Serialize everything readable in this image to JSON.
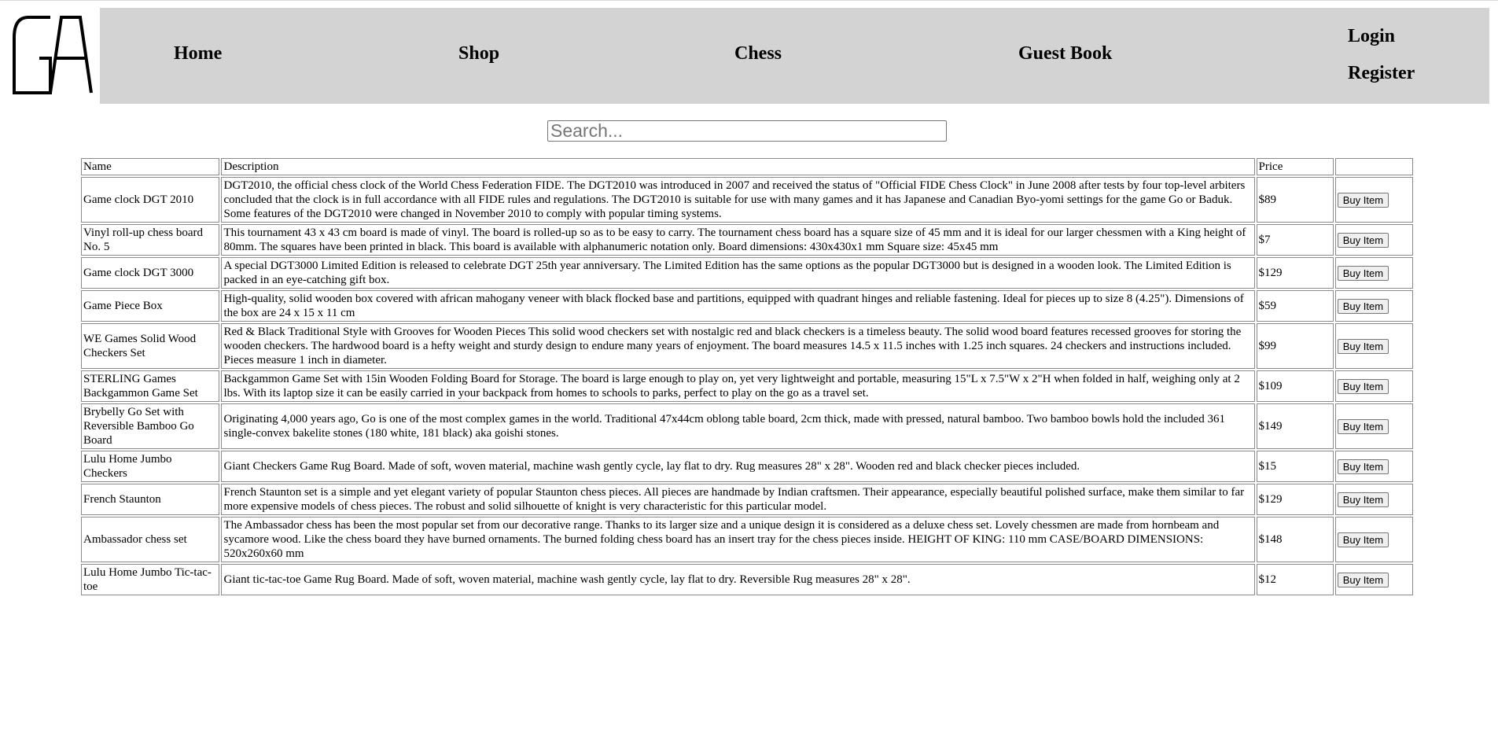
{
  "logo": {
    "text": "GA"
  },
  "nav": {
    "home": "Home",
    "shop": "Shop",
    "chess": "Chess",
    "guest_book": "Guest Book",
    "login": "Login",
    "register": "Register"
  },
  "search": {
    "placeholder": "Search..."
  },
  "table": {
    "headers": {
      "name": "Name",
      "description": "Description",
      "price": "Price"
    },
    "buy_label": "Buy Item",
    "rows": [
      {
        "name": "Game clock DGT 2010",
        "description": "DGT2010, the official chess clock of the World Chess Federation FIDE. The DGT2010 was introduced in 2007 and received the status of \"Official FIDE Chess Clock\" in June 2008 after tests by four top-level arbiters concluded that the clock is in full accordance with all FIDE rules and regulations. The DGT2010 is suitable for use with many games and it has Japanese and Canadian Byo-yomi settings for the game Go or Baduk. Some features of the DGT2010 were changed in November 2010 to comply with popular timing systems.",
        "price": "$89"
      },
      {
        "name": "Vinyl roll-up chess board No. 5",
        "description": "This tournament 43 x 43 cm board is made of vinyl. The board is rolled-up so as to be easy to carry. The tournament chess board has a square size of 45 mm and it is ideal for our larger chessmen with a King height of 80mm. The squares have been printed in black. This board is available with alphanumeric notation only. Board dimensions: 430x430x1 mm Square size: 45x45 mm",
        "price": "$7"
      },
      {
        "name": "Game clock DGT 3000",
        "description": "A special DGT3000 Limited Edition is released to celebrate DGT 25th year anniversary. The Limited Edition has the same options as the popular DGT3000 but is designed in a wooden look. The Limited Edition is packed in an eye-catching gift box.",
        "price": "$129"
      },
      {
        "name": "Game Piece Box",
        "description": "High-quality, solid wooden box covered with african mahogany veneer with black flocked base and partitions, equipped with quadrant hinges and reliable fastening. Ideal for pieces up to size 8 (4.25\"). Dimensions of the box are 24 x 15 x 11 cm",
        "price": "$59"
      },
      {
        "name": "WE Games Solid Wood Checkers Set",
        "description": "Red & Black Traditional Style with Grooves for Wooden Pieces This solid wood checkers set with nostalgic red and black checkers is a timeless beauty. The solid wood board features recessed grooves for storing the wooden checkers. The hardwood board is a hefty weight and sturdy design to endure many years of enjoyment. The board measures 14.5 x 11.5 inches with 1.25 inch squares. 24 checkers and instructions included. Pieces measure 1 inch in diameter.",
        "price": "$99"
      },
      {
        "name": "STERLING Games Backgammon Game Set",
        "description": "Backgammon Game Set with 15in Wooden Folding Board for Storage. The board is large enough to play on, yet very lightweight and portable, measuring 15\"L x 7.5\"W x 2\"H when folded in half, weighing only at 2 lbs. With its laptop size it can be easily carried in your backpack from homes to schools to parks, perfect to play on the go as a travel set.",
        "price": "$109"
      },
      {
        "name": "Brybelly Go Set with Reversible Bamboo Go Board",
        "description": "Originating 4,000 years ago, Go is one of the most complex games in the world. Traditional 47x44cm oblong table board, 2cm thick, made with pressed, natural bamboo. Two bamboo bowls hold the included 361 single-convex bakelite stones (180 white, 181 black) aka goishi stones.",
        "price": "$149"
      },
      {
        "name": "Lulu Home Jumbo Checkers",
        "description": "Giant Checkers Game Rug Board. Made of soft, woven material, machine wash gently cycle, lay flat to dry. Rug measures 28\" x 28\". Wooden red and black checker pieces included.",
        "price": "$15"
      },
      {
        "name": "French Staunton",
        "description": "French Staunton set is a simple and yet elegant variety of popular Staunton chess pieces. All pieces are handmade by Indian craftsmen. Their appearance, especially beautiful polished surface, make them similar to far more expensive models of chess pieces. The robust and solid silhouette of knight is very characteristic for this particular model.",
        "price": "$129"
      },
      {
        "name": "Ambassador chess set",
        "description": "The Ambassador chess has been the most popular set from our decorative range. Thanks to its larger size and a unique design it is considered as a deluxe chess set. Lovely chessmen are made from hornbeam and sycamore wood. Like the chess board they have burned ornaments. The burned folding chess board has an insert tray for the chess pieces inside. HEIGHT OF KING: 110 mm CASE/BOARD DIMENSIONS: 520x260x60 mm",
        "price": "$148"
      },
      {
        "name": "Lulu Home Jumbo Tic-tac-toe",
        "description": "Giant tic-tac-toe Game Rug Board. Made of soft, woven material, machine wash gently cycle, lay flat to dry. Reversible Rug measures 28\" x 28\".",
        "price": "$12"
      }
    ]
  }
}
